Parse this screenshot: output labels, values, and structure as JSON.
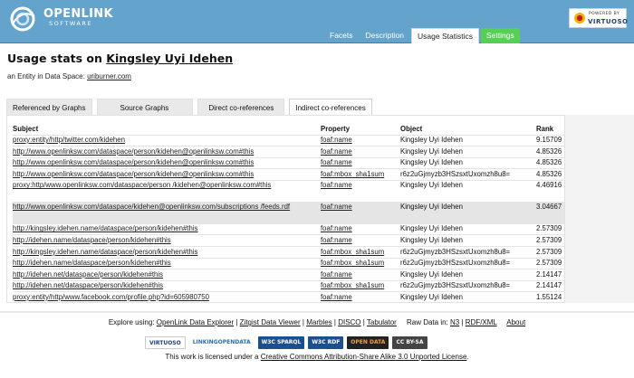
{
  "header": {
    "logo_text": "OPENLINK",
    "logo_sub": "SOFTWARE",
    "virtuoso_powered": "POWERED BY",
    "virtuoso_name": "VIRTUOSO",
    "tabs": [
      "Facets",
      "Description",
      "Usage Statistics",
      "Settings"
    ]
  },
  "title": {
    "prefix": "Usage stats on",
    "name": "Kingsley Uyi Idehen"
  },
  "entity": {
    "prefix": "an Entity in Data Space:",
    "space": "uriburner.com"
  },
  "content_tabs": [
    "Referenced by Graphs",
    "Source Graphs",
    "Direct co-references",
    "Indirect co-references"
  ],
  "table": {
    "headers": [
      "Subject",
      "Property",
      "Object",
      "Rank"
    ],
    "rows": [
      {
        "subject": "proxy:entity/http/twitter.com/kidehen",
        "property": "foaf:name",
        "object": "Kingsley Uyi Idehen",
        "rank": "9.15709"
      },
      {
        "subject": "http://www.openlinksw.com/dataspace/person/kidehen@openlinksw.com#this",
        "property": "foaf:name",
        "object": "Kingsley Uyi Idehen",
        "rank": "4.85326"
      },
      {
        "subject": "http://www.openlinksw.com/dataspace/person/kidehen@openlinksw.com#this",
        "property": "foaf:name",
        "object": "Kingsley Uyi Idehen",
        "rank": "4.85326"
      },
      {
        "subject": "http://www.openlinksw.com/dataspace/person/kidehen@openlinksw.com#this",
        "property": "foaf:mbox_sha1sum",
        "object": "r6z2uGjmyzb3HSzsxtUxomzh8u8=",
        "rank": "4.85326"
      },
      {
        "subject": "proxy:http/www.openlinksw.com/dataspace/person /kidehen@openlinksw.com#this",
        "property": "foaf:name",
        "object": "Kingsley Uyi Idehen",
        "rank": "4.46916"
      },
      {
        "subject": "http://www.openlinksw.com/dataspace/kidehen@openlinksw.com/subscriptions /feeds.rdf",
        "property": "foaf:name",
        "object": "Kingsley Uyi Idehen",
        "rank": "3.04667"
      },
      {
        "subject": "http://kingsley.idehen.name/dataspace/person/kidehen#this",
        "property": "foaf:name",
        "object": "Kingsley Uyi Idehen",
        "rank": "2.57309"
      },
      {
        "subject": "http://idehen.name/dataspace/person/kidehen#this",
        "property": "foaf:name",
        "object": "Kingsley Uyi Idehen",
        "rank": "2.57309"
      },
      {
        "subject": "http://kingsley.idehen.name/dataspace/person/kidehen#this",
        "property": "foaf:mbox_sha1sum",
        "object": "r6z2uGjmyzb3HSzsxtUxomzh8u8=",
        "rank": "2.57309"
      },
      {
        "subject": "http://idehen.name/dataspace/person/kidehen#this",
        "property": "foaf:mbox_sha1sum",
        "object": "r6z2uGjmyzb3HSzsxtUxomzh8u8=",
        "rank": "2.57309"
      },
      {
        "subject": "http://idehen.net/dataspace/person/kidehen#this",
        "property": "foaf:name",
        "object": "Kingsley Uyi Idehen",
        "rank": "2.14147"
      },
      {
        "subject": "http://idehen.net/dataspace/person/kidehen#this",
        "property": "foaf:mbox_sha1sum",
        "object": "r6z2uGjmyzb3HSzsxtUxomzh8u8=",
        "rank": "2.14147"
      },
      {
        "subject": "proxy:entity/http/www.facebook.com/profile.php?id=605980750",
        "property": "foaf:name",
        "object": "Kingsley Uyi Idehen",
        "rank": "1.55124"
      }
    ]
  },
  "footer": {
    "explore_label": "Explore using:",
    "explore_links": [
      "OpenLink Data Explorer",
      "Zitgist Data Viewer",
      "Marbles",
      "DISCO",
      "Tabulator"
    ],
    "raw_label": "Raw Data in:",
    "raw_links": [
      "N3",
      "RDF/XML"
    ],
    "about": "About",
    "badges": [
      "VIRTUOSO",
      "LINKINGOPENDATA",
      "W3C SPARQL",
      "W3C RDF",
      "OPEN DATA",
      "CC BY-SA"
    ],
    "license_prefix": "This work is licensed under a",
    "license_link": "Creative Commons Attribution-Share Alike 3.0 Unported License",
    "license_suffix": "."
  },
  "colors": {
    "header": "#63a3cc",
    "settings": "#55d055",
    "highlight_row": "#e5e5e5"
  }
}
